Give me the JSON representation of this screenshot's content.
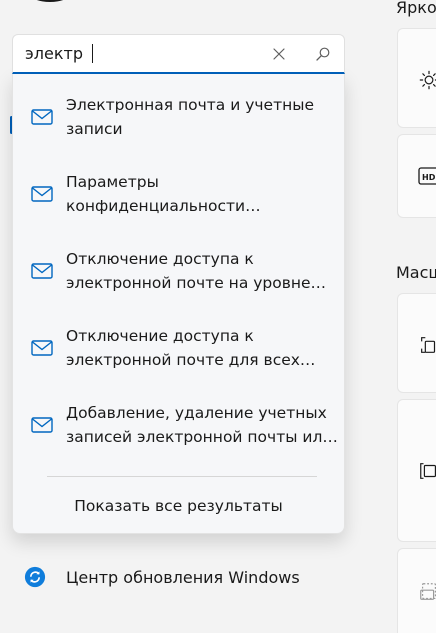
{
  "search": {
    "value": "электр",
    "clear_icon": "close-icon",
    "search_icon": "search-icon"
  },
  "results": [
    {
      "line1": "Электронная почта и учетные",
      "line2": "записи",
      "icon": "mail-icon"
    },
    {
      "line1": "Параметры",
      "line2": "конфиденциальности…",
      "icon": "mail-icon"
    },
    {
      "line1": "Отключение доступа к",
      "line2": "электронной почте на уровне…",
      "icon": "mail-icon"
    },
    {
      "line1": "Отключение доступа к",
      "line2": "электронной почте для всех…",
      "icon": "mail-icon"
    },
    {
      "line1": "Добавление, удаление учетных",
      "line2": "записей электронной почты ил…",
      "icon": "mail-icon"
    }
  ],
  "show_all_label": "Показать все результаты",
  "nav": {
    "update_label": "Центр обновления Windows",
    "update_icon": "windows-update-icon"
  },
  "right_panel": {
    "brightness_heading": "Ярко",
    "scale_heading": "Масш",
    "hdr_badge": "HDR"
  },
  "colors": {
    "accent": "#005fb8",
    "mail_icon": "#0067c0",
    "update_icon": "#0f7ddb"
  }
}
